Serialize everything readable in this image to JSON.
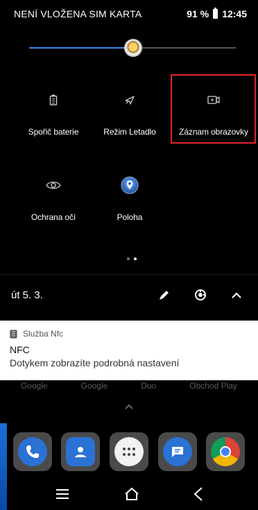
{
  "status_bar": {
    "carrier": "NENÍ VLOŽENA SIM KARTA",
    "battery": "91 %",
    "time": "12:45"
  },
  "brightness": {
    "level_percent": 50
  },
  "tiles": [
    {
      "label": "Spořič baterie",
      "icon": "battery-saver-icon"
    },
    {
      "label": "Režim Letadlo",
      "icon": "airplane-icon"
    },
    {
      "label": "Záznam obrazovky",
      "icon": "screen-record-icon",
      "highlighted": true
    },
    {
      "label": "Ochrana očí",
      "icon": "eye-icon"
    },
    {
      "label": "Poloha",
      "icon": "location-icon"
    }
  ],
  "page_indicator": {
    "pages": 2,
    "active": 2
  },
  "footer": {
    "date": "út 5. 3."
  },
  "notification": {
    "app": "Služba Nfc",
    "title": "NFC",
    "text": "Dotykem zobrazíte podrobná nastavení"
  },
  "home_app_labels": [
    "Google",
    "Google",
    "Duo",
    "Obchod Play"
  ],
  "dock": [
    "phone-icon",
    "contacts-icon",
    "app-drawer-icon",
    "messages-icon",
    "chrome-icon"
  ],
  "colors": {
    "accent": "#3f8be8",
    "highlight_border": "#e0262a"
  }
}
